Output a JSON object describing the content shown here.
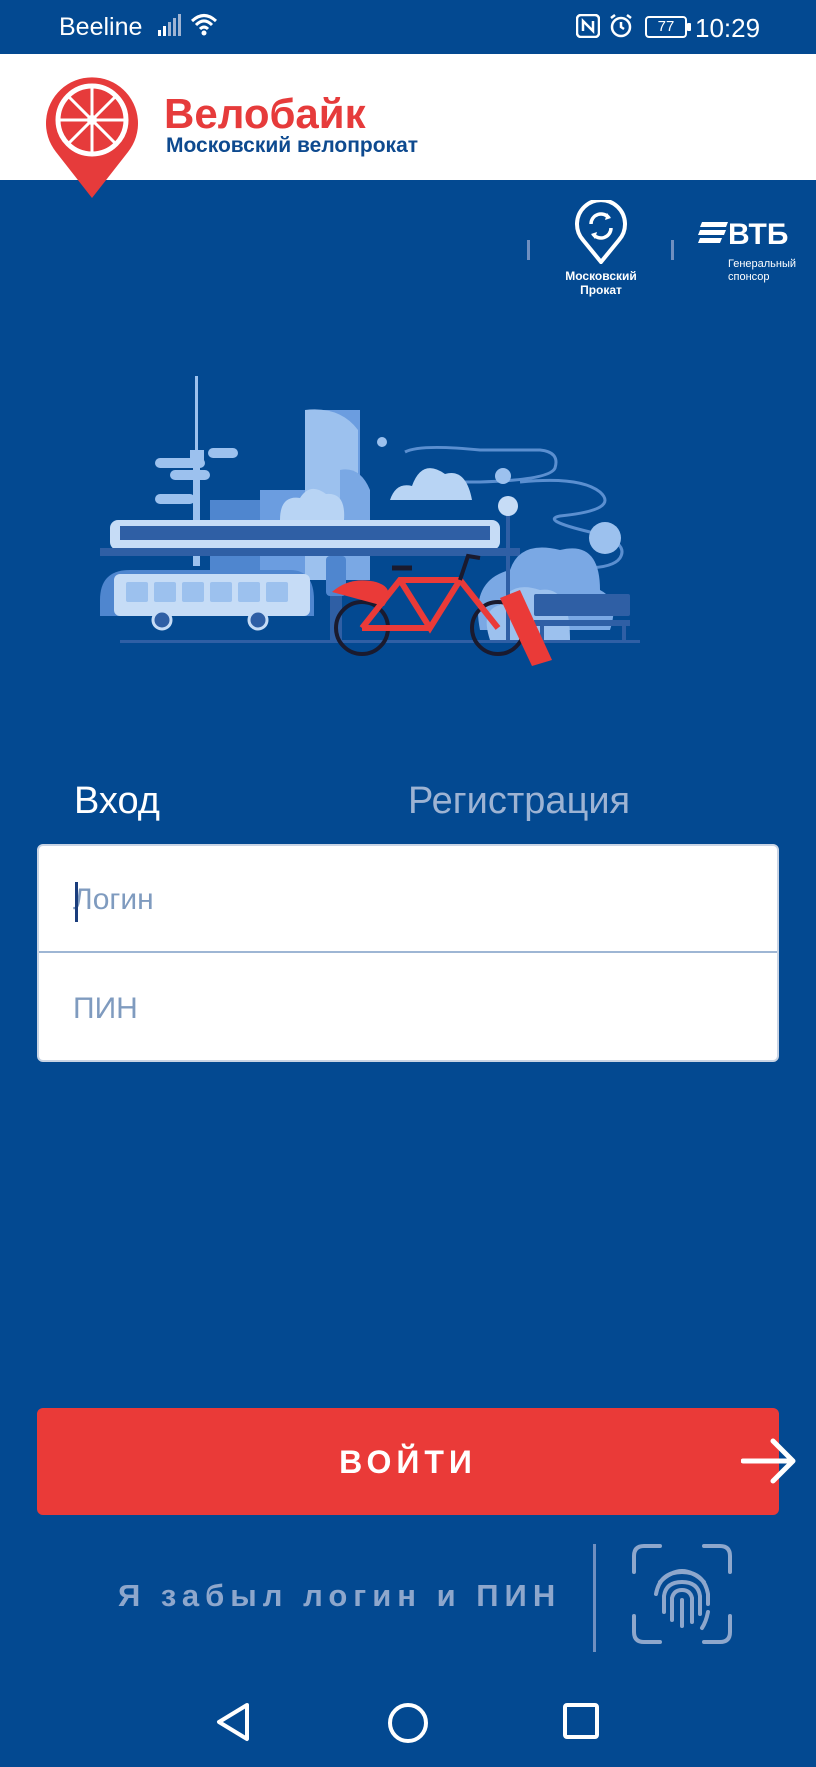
{
  "status_bar": {
    "carrier": "Beeline",
    "battery": "77",
    "time": "10:29",
    "icons": [
      "signal-icon",
      "wifi-icon",
      "nfc-icon",
      "alarm-icon",
      "battery-icon"
    ]
  },
  "header": {
    "brand_name": "Велобайк",
    "brand_subtitle": "Московский велопрокат",
    "logo_icon": "bike-wheel-pin-icon",
    "brand_color": "#e63b3b"
  },
  "sponsors": {
    "moscow_rental_caption_line1": "Московский",
    "moscow_rental_caption_line2": "Прокат",
    "vtb_name": "ВТБ",
    "vtb_sub_line1": "Генеральный",
    "vtb_sub_line2": "спонсор"
  },
  "illustration": {
    "icon": "city-bike-illustration"
  },
  "tabs": {
    "login": "Вход",
    "register": "Регистрация",
    "active": "login"
  },
  "form": {
    "login_placeholder": "Логин",
    "login_value": "",
    "pin_placeholder": "ПИН",
    "pin_value": ""
  },
  "actions": {
    "submit_label": "ВОЙТИ",
    "submit_color": "#ea3a38",
    "forgot_label": "Я забыл логин и ПИН",
    "fingerprint_icon": "fingerprint-icon"
  },
  "navbar": {
    "icons": [
      "back-icon",
      "home-icon",
      "recent-apps-icon"
    ]
  },
  "colors": {
    "background": "#034991",
    "accent": "#ea3a38"
  }
}
